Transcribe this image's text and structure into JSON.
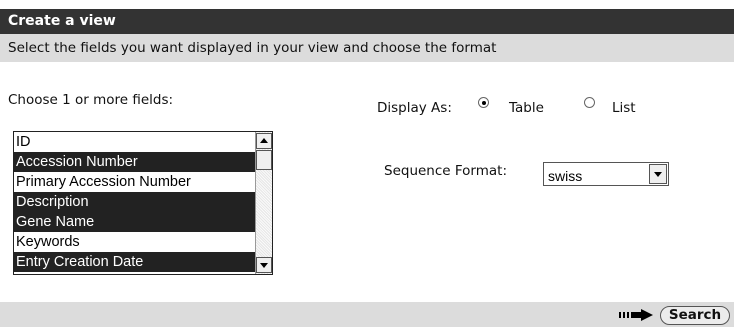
{
  "header": {
    "title": "Create a view"
  },
  "subheader": {
    "text": "Select the fields you want displayed in your view and choose the format"
  },
  "fields": {
    "label": "Choose 1 or more fields:",
    "items": [
      {
        "label": "ID",
        "selected": false
      },
      {
        "label": "Accession Number",
        "selected": true
      },
      {
        "label": "Primary Accession Number",
        "selected": false
      },
      {
        "label": "Description",
        "selected": true
      },
      {
        "label": "Gene Name",
        "selected": true
      },
      {
        "label": "Keywords",
        "selected": false
      },
      {
        "label": "Entry Creation Date",
        "selected": true
      }
    ]
  },
  "display": {
    "label": "Display As:",
    "options": [
      {
        "label": "Table",
        "selected": true
      },
      {
        "label": "List",
        "selected": false
      }
    ]
  },
  "sequence": {
    "label": "Sequence Format:",
    "value": "swiss"
  },
  "footer": {
    "search_label": "Search"
  }
}
